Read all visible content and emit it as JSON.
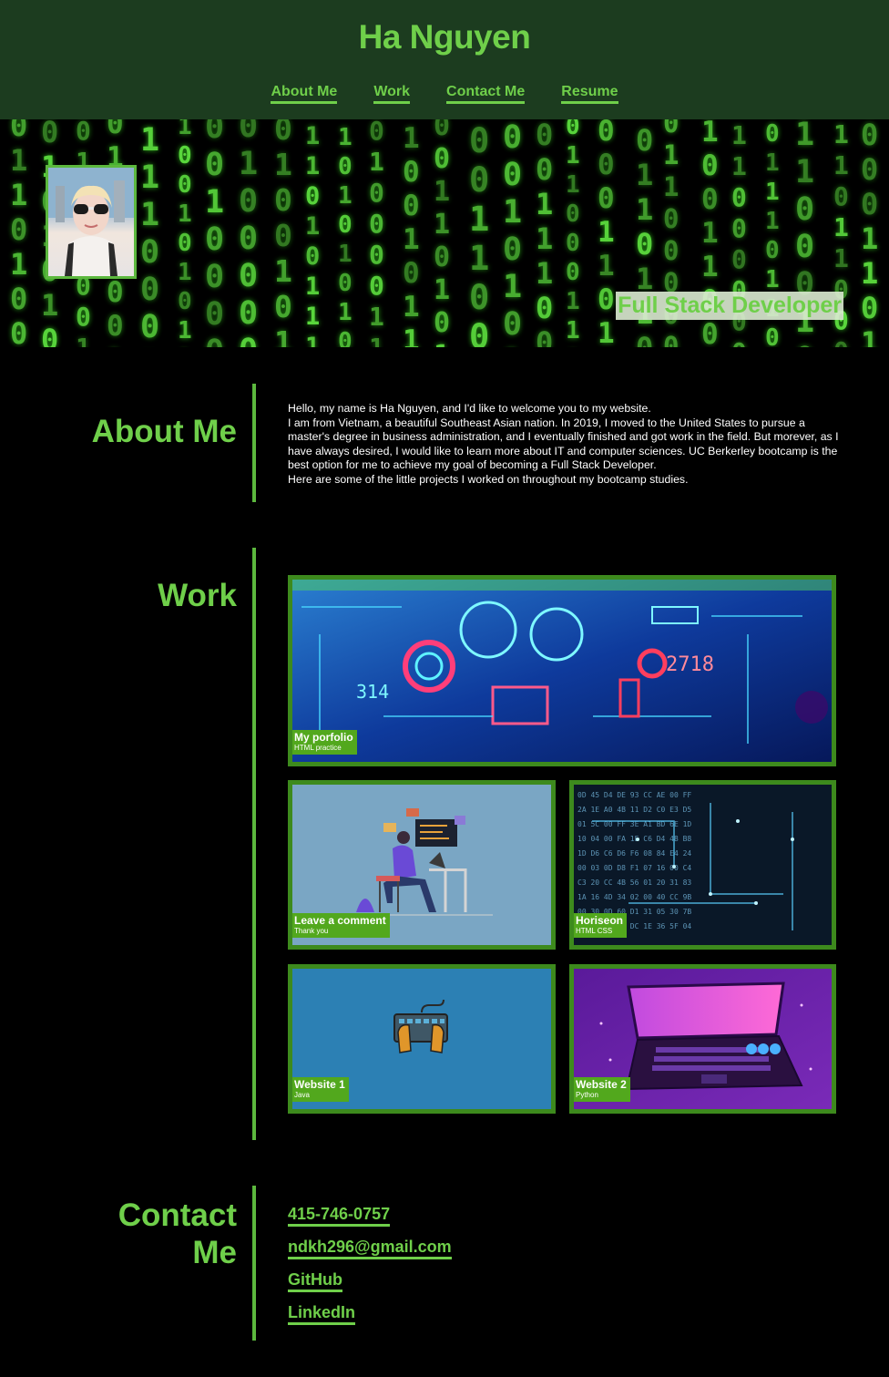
{
  "header": {
    "title": "Ha Nguyen",
    "nav": [
      {
        "label": "About Me"
      },
      {
        "label": "Work"
      },
      {
        "label": "Contact Me"
      },
      {
        "label": "Resume"
      }
    ]
  },
  "hero": {
    "subtitle": "Full Stack Developer"
  },
  "about": {
    "heading": "About Me",
    "lines": [
      "Hello, my name is Ha Nguyen, and I'd like to welcome you to my website.",
      "I am from Vietnam, a beautiful Southeast Asian nation. In 2019, I moved to the United States to pursue a master's degree in business administration, and I eventually finished and got work in the field. But morever, as I have always desired, I would like to learn more about IT and computer sciences. UC Berkerley bootcamp is the best option for me to achieve my goal of becoming a Full Stack Developer.",
      "Here are some of the little projects I worked on throughout my bootcamp studies."
    ]
  },
  "work": {
    "heading": "Work",
    "projects": [
      {
        "title": "My porfolio",
        "subtitle": "HTML practice"
      },
      {
        "title": "Leave a comment",
        "subtitle": "Thank you"
      },
      {
        "title": "Horiseon",
        "subtitle": "HTML CSS"
      },
      {
        "title": "Website 1",
        "subtitle": "Java"
      },
      {
        "title": "Website 2",
        "subtitle": "Python"
      }
    ]
  },
  "contact": {
    "heading_line1": "Contact",
    "heading_line2": "Me",
    "links": [
      {
        "label": "415-746-0757"
      },
      {
        "label": "ndkh296@gmail.com"
      },
      {
        "label": "GitHub"
      },
      {
        "label": "LinkedIn"
      }
    ]
  },
  "colors": {
    "accent": "#6fcf4a",
    "header_bg": "#1c3c1f",
    "card_border": "#3d8a1d",
    "caption_bg": "#52a81d"
  }
}
